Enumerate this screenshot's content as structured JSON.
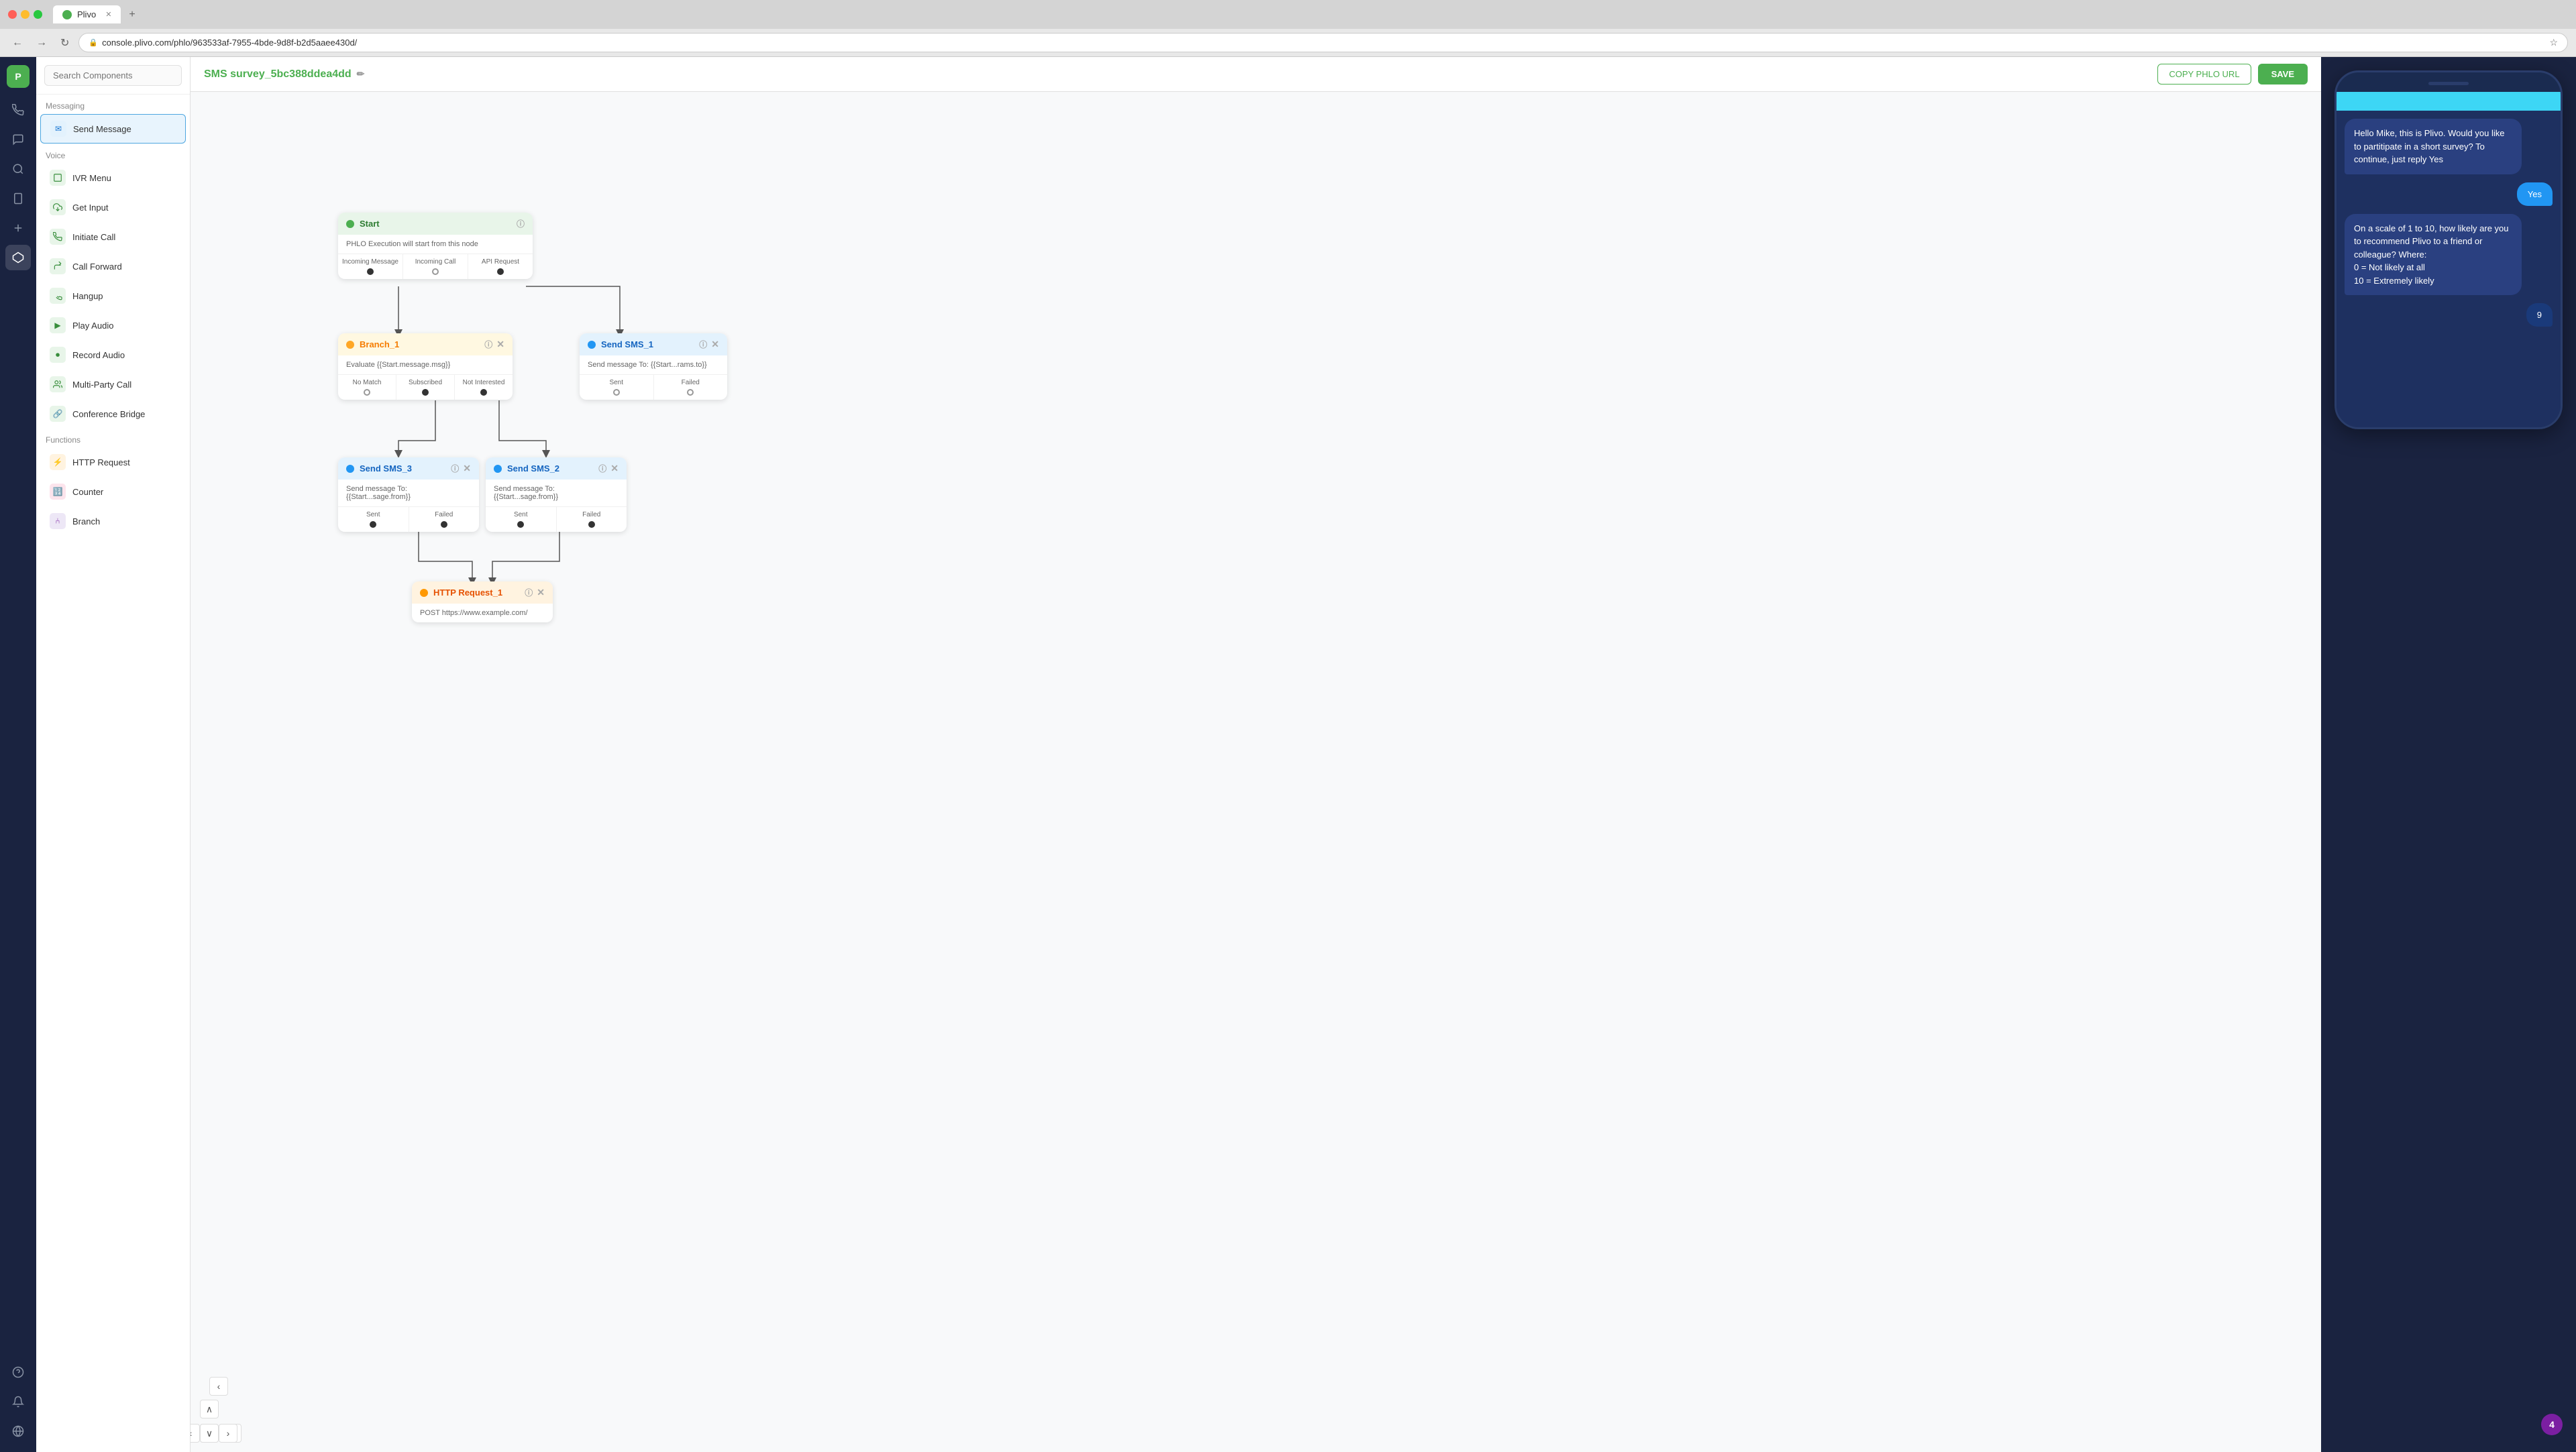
{
  "browser": {
    "tab_title": "Plivo",
    "url": "console.plivo.com/phlo/963533af-7955-4bde-9d8f-b2d5aaee430d/",
    "nav_back": "←",
    "nav_forward": "→",
    "nav_refresh": "↻"
  },
  "topbar": {
    "title": "SMS survey_5bc388ddea4dd",
    "copy_url_label": "COPY PHLO URL",
    "save_label": "SAVE"
  },
  "sidebar": {
    "items": [
      {
        "id": "logo",
        "icon": "P"
      },
      {
        "id": "phone",
        "icon": "📞"
      },
      {
        "id": "messages",
        "icon": "💬"
      },
      {
        "id": "search",
        "icon": "🔍"
      },
      {
        "id": "sms",
        "icon": "📱"
      },
      {
        "id": "plus",
        "icon": "➕"
      },
      {
        "id": "flow",
        "icon": "⬡"
      },
      {
        "id": "help",
        "icon": "?"
      },
      {
        "id": "notification",
        "icon": "🔔"
      },
      {
        "id": "globe",
        "icon": "🌐"
      }
    ]
  },
  "components": {
    "search_placeholder": "Search Components",
    "messaging_label": "Messaging",
    "voice_label": "Voice",
    "functions_label": "Functions",
    "items": [
      {
        "id": "send-message",
        "label": "Send Message",
        "group": "messaging",
        "icon": "✉"
      },
      {
        "id": "ivr-menu",
        "label": "IVR Menu",
        "group": "voice",
        "icon": "🎛"
      },
      {
        "id": "get-input",
        "label": "Get Input",
        "group": "voice",
        "icon": "📥"
      },
      {
        "id": "initiate-call",
        "label": "Initiate Call",
        "group": "voice",
        "icon": "📲"
      },
      {
        "id": "call-forward",
        "label": "Call Forward",
        "group": "voice",
        "icon": "↗"
      },
      {
        "id": "hangup",
        "label": "Hangup",
        "group": "voice",
        "icon": "📴"
      },
      {
        "id": "play-audio",
        "label": "Play Audio",
        "group": "voice",
        "icon": "▶"
      },
      {
        "id": "record-audio",
        "label": "Record Audio",
        "group": "voice",
        "icon": "⏺"
      },
      {
        "id": "multi-party-call",
        "label": "Multi-Party Call",
        "group": "voice",
        "icon": "👥"
      },
      {
        "id": "conference-bridge",
        "label": "Conference Bridge",
        "group": "voice",
        "icon": "🔗"
      },
      {
        "id": "http-request",
        "label": "HTTP Request",
        "group": "functions",
        "icon": "⚡"
      },
      {
        "id": "counter",
        "label": "Counter",
        "group": "functions",
        "icon": "🔢"
      },
      {
        "id": "branch",
        "label": "Branch",
        "group": "functions",
        "icon": "⑃"
      }
    ]
  },
  "nodes": {
    "start": {
      "title": "Start",
      "description": "PHLO Execution will start from this node",
      "ports": [
        "Incoming Message",
        "Incoming Call",
        "API Request"
      ]
    },
    "branch_1": {
      "title": "Branch_1",
      "body": "Evaluate {{Start.message.msg}}",
      "ports": [
        "No Match",
        "Subscribed",
        "Not Interested"
      ]
    },
    "send_sms_1": {
      "title": "Send SMS_1",
      "body": "Send message To: {{Start...rams.to}}",
      "ports": [
        "Sent",
        "Failed"
      ]
    },
    "send_sms_2": {
      "title": "Send SMS_2",
      "body": "Send message To: {{Start...sage.from}}",
      "ports": [
        "Sent",
        "Failed"
      ]
    },
    "send_sms_3": {
      "title": "Send SMS_3",
      "body": "Send message To: {{Start...sage.from}}",
      "ports": [
        "Sent",
        "Failed"
      ]
    },
    "http_request_1": {
      "title": "HTTP Request_1",
      "body": "POST https://www.example.com/"
    }
  },
  "phone": {
    "messages": [
      {
        "type": "incoming",
        "text": "Hello Mike, this is Plivo. Would you like to partitipate in a short survey? To continue, just reply Yes"
      },
      {
        "type": "outgoing",
        "text": "Yes",
        "style": "blue"
      },
      {
        "type": "incoming",
        "text": "On a scale of 1 to 10, how likely are you to recommend Plivo to a friend or colleague? Where:\n0 = Not likely at all\n10 = Extremely likely"
      },
      {
        "type": "outgoing",
        "text": "9",
        "style": "dark"
      }
    ],
    "badge": "4"
  }
}
